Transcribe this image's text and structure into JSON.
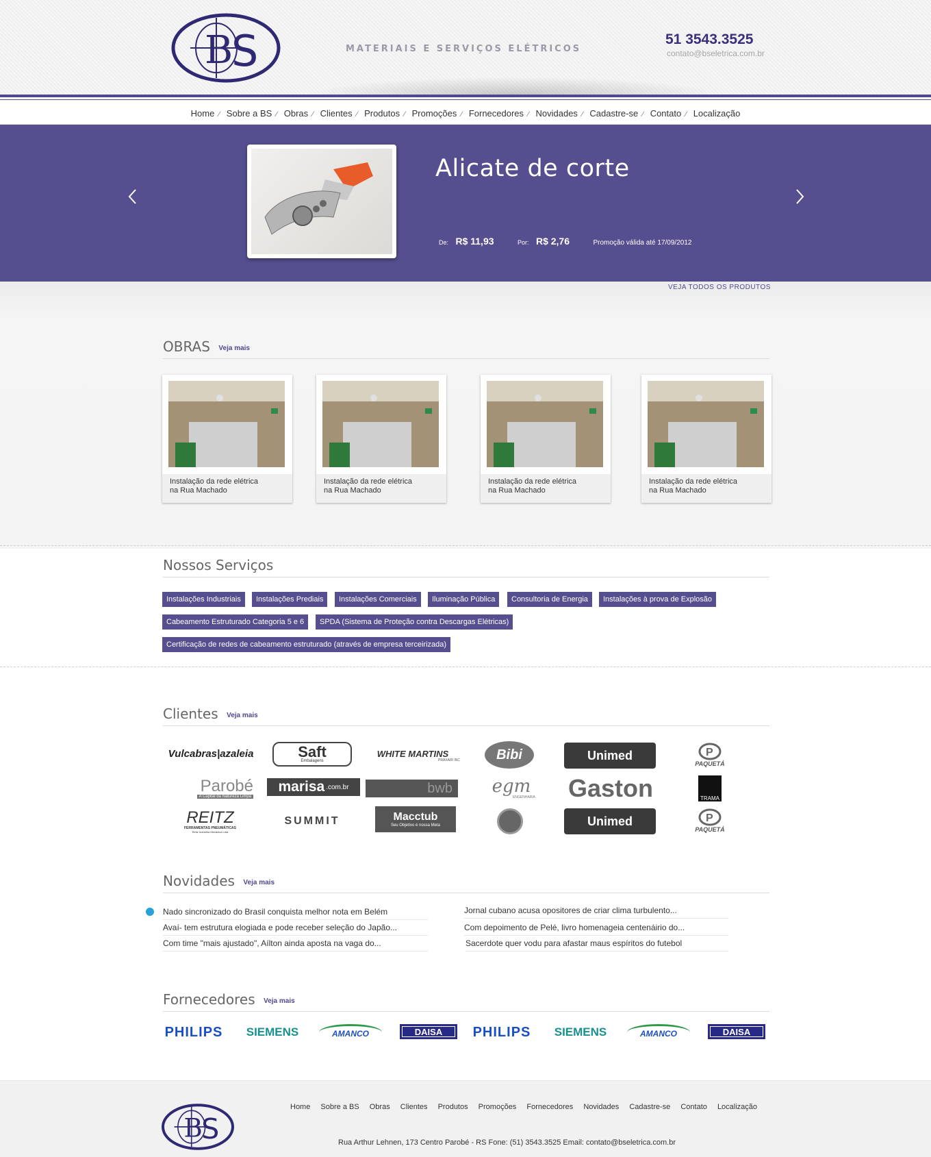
{
  "header": {
    "tagline": "MATERIAIS E SERVIÇOS ELÉTRICOS",
    "phone": "51 3543.3525",
    "email": "contato@bseletrica.com.br"
  },
  "nav": [
    "Home",
    "Sobre a BS",
    "Obras",
    "Clientes",
    "Produtos",
    "Promoções",
    "Fornecedores",
    "Novidades",
    "Cadastre-se",
    "Contato",
    "Localização"
  ],
  "slider": {
    "title": "Alicate de corte",
    "de_label": "De:",
    "de_price": "R$ 11,93",
    "por_label": "Por:",
    "por_price": "R$ 2,76",
    "promo": "Promoção válida até 17/09/2012",
    "see_all": "VEJA TODOS OS PRODUTOS"
  },
  "obras": {
    "title": "OBRAS",
    "more": "Veja mais",
    "cards": [
      {
        "line1": "Instalação da rede elétrica",
        "line2": "na Rua Machado"
      },
      {
        "line1": "Instalação da rede elétrica",
        "line2": "na Rua Machado"
      },
      {
        "line1": "Instalação da rede elétrica",
        "line2": "na Rua Machado"
      },
      {
        "line1": "Instalação da rede elétrica",
        "line2": "na Rua Machado"
      }
    ]
  },
  "servicos": {
    "title": "Nossos Serviços",
    "items": [
      "Instalações Industriais",
      "Instalações Prediais",
      "Instalações Comerciais",
      "Iluminação Pública",
      "Consultoria de Energia",
      "Instalações à prova de Explosão",
      "Cabeamento Estruturado Categoria 5 e 6",
      "SPDA (Sistema de Proteção contra Descargas Elétricas)",
      "Certificação de redes de cabeamento estruturado (através de empresa terceirizada)"
    ]
  },
  "clientes": {
    "title": "Clientes",
    "more": "Veja mais",
    "logos": [
      "Vulcabras|azaleia",
      "Saft",
      "Embalagens",
      "WHITE MARTINS",
      "PRAXAIR INC",
      "Bibi",
      "Unimed",
      "PAQUETÁ",
      "Parobé",
      "A Capital da Natureza Limpa",
      "marisa",
      ".com.br",
      "bwb",
      "egm",
      "ENGENHARIA",
      "Gaston",
      "TRAMA",
      "REITZ",
      "FERRAMENTAS PNEUMÁTICAS",
      "Reitz Indústria Mecânica Ltda",
      "SUMMIT",
      "Macctub",
      "Seu Objetivo é nossa Meta",
      "Unimed",
      "PAQUETÁ"
    ]
  },
  "novidades": {
    "title": "Novidades",
    "more": "Veja mais",
    "left": [
      "Nado sincronizado do Brasil conquista melhor nota em Belém",
      "Avaí- tem estrutura elogiada e pode receber seleção do Japão...",
      "Com time \"mais ajustado\", Aílton ainda aposta na vaga do..."
    ],
    "right": [
      "Jornal cubano acusa opositores de criar clima turbulento...",
      "Com depoimento de Pelé, livro homenageia centenáirio do...",
      "Sacerdote quer vodu para afastar maus espíritos do futebol"
    ]
  },
  "fornecedores": {
    "title": "Fornecedores",
    "more": "Veja mais",
    "logos": [
      "PHILIPS",
      "SIEMENS",
      "AMANCO",
      "DAISA",
      "PHILIPS",
      "SIEMENS",
      "AMANCO",
      "DAISA"
    ]
  },
  "footer": {
    "nav": [
      "Home",
      "Sobre a BS",
      "Obras",
      "Clientes",
      "Produtos",
      "Promoções",
      "Fornecedores",
      "Novidades",
      "Cadastre-se",
      "Contato",
      "Localização"
    ],
    "address": "Rua Arthur Lehnen, 173 Centro Parobé - RS Fone: (51) 3543.3525 Email: contato@bseletrica.com.br"
  },
  "colors": {
    "brand": "#554f90",
    "brand_dark": "#3b2f7a",
    "bullet": "#2aa2d9"
  }
}
